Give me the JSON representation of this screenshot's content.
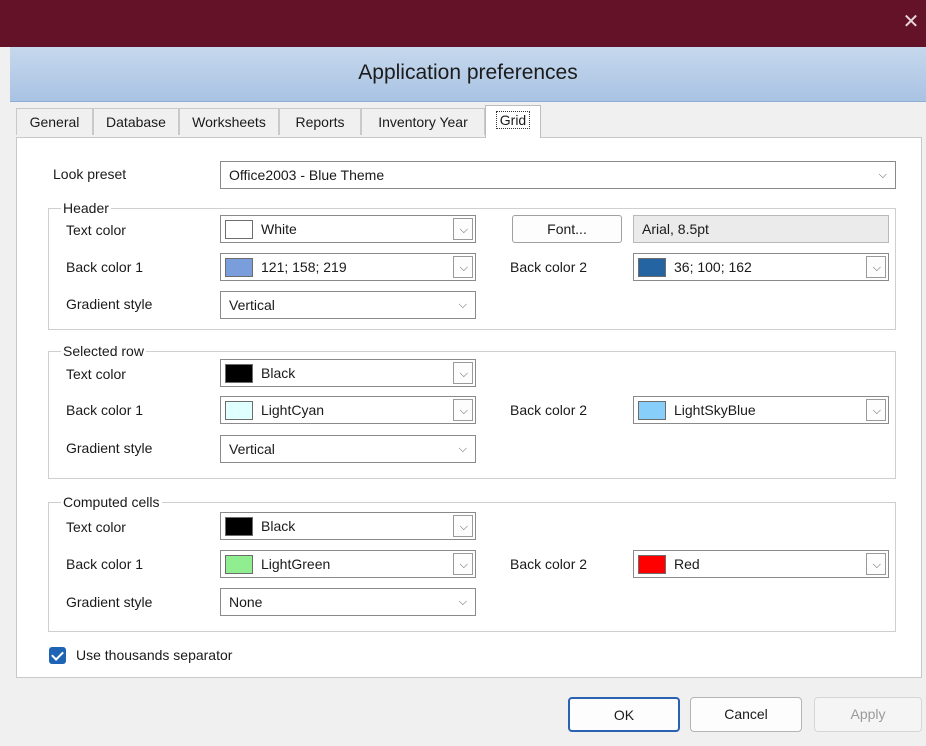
{
  "window": {
    "close_glyph": "✕",
    "title": "Application preferences",
    "titlebar_color": "#631227"
  },
  "tabs": [
    {
      "label": "General"
    },
    {
      "label": "Database"
    },
    {
      "label": "Worksheets"
    },
    {
      "label": "Reports"
    },
    {
      "label": "Inventory Year"
    },
    {
      "label": "Grid",
      "active": true
    }
  ],
  "look_preset": {
    "label": "Look preset",
    "value": "Office2003 - Blue Theme"
  },
  "header_group": {
    "title": "Header",
    "text_color": {
      "label": "Text color",
      "value": "White",
      "swatch": "#ffffff"
    },
    "back_color_1": {
      "label": "Back color 1",
      "value": "121; 158; 219",
      "swatch": "#799edb"
    },
    "back_color_2": {
      "label": "Back color 2",
      "value": "36; 100; 162",
      "swatch": "#2464a2"
    },
    "gradient_style": {
      "label": "Gradient style",
      "value": "Vertical"
    },
    "font_button": "Font...",
    "font_value": "Arial, 8.5pt"
  },
  "selected_row_group": {
    "title": "Selected row",
    "text_color": {
      "label": "Text color",
      "value": "Black",
      "swatch": "#000000"
    },
    "back_color_1": {
      "label": "Back color 1",
      "value": "LightCyan",
      "swatch": "#e0ffff"
    },
    "back_color_2": {
      "label": "Back color 2",
      "value": "LightSkyBlue",
      "swatch": "#87cefa"
    },
    "gradient_style": {
      "label": "Gradient style",
      "value": "Vertical"
    }
  },
  "computed_cells_group": {
    "title": "Computed cells",
    "text_color": {
      "label": "Text color",
      "value": "Black",
      "swatch": "#000000"
    },
    "back_color_1": {
      "label": "Back color 1",
      "value": "LightGreen",
      "swatch": "#90ee90"
    },
    "back_color_2": {
      "label": "Back color 2",
      "value": "Red",
      "swatch": "#ff0000"
    },
    "gradient_style": {
      "label": "Gradient style",
      "value": "None"
    }
  },
  "thousands_separator": {
    "label": "Use thousands separator",
    "checked": true
  },
  "buttons": {
    "ok": "OK",
    "cancel": "Cancel",
    "apply": "Apply"
  },
  "glyphs": {
    "chevron_down": "⌵"
  }
}
